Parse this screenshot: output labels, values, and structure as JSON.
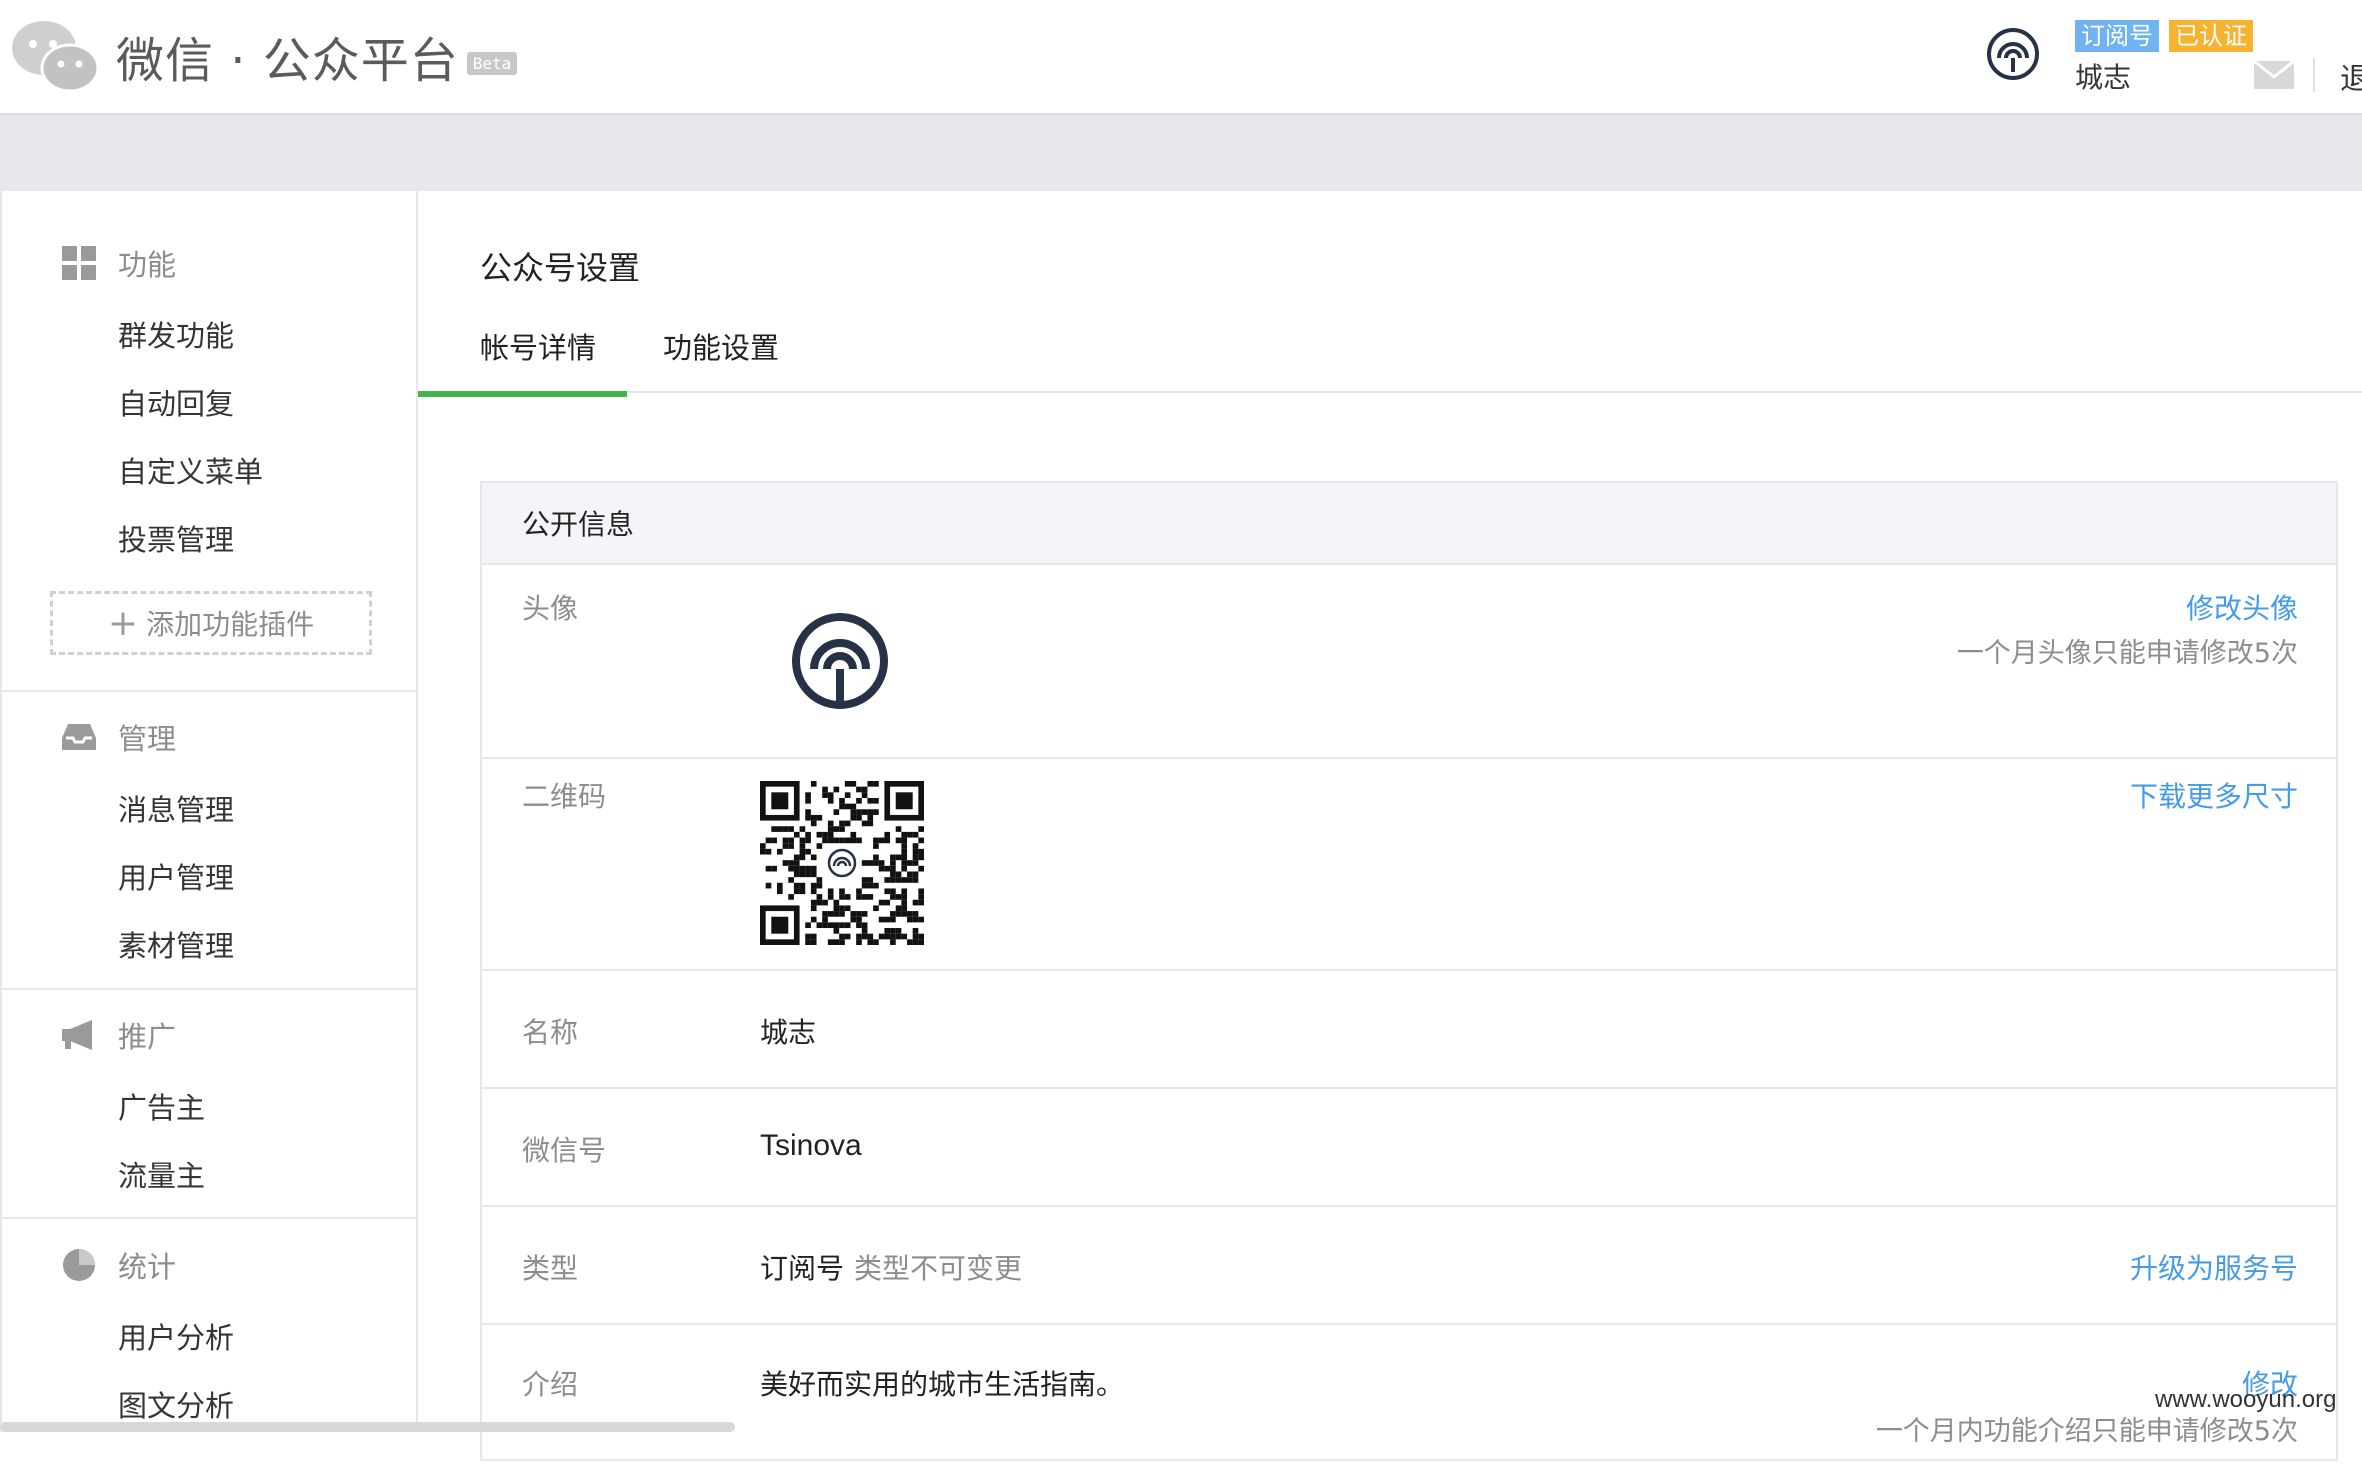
{
  "header": {
    "logo_title": "微信 · 公众平台",
    "beta": "Beta",
    "badge_type": "订阅号",
    "badge_verified": "已认证",
    "account_name": "城志",
    "logout": "退"
  },
  "sidebar": {
    "groups": [
      {
        "title": "功能",
        "icon": "grid-icon",
        "items": [
          "群发功能",
          "自动回复",
          "自定义菜单",
          "投票管理"
        ]
      },
      {
        "title": "管理",
        "icon": "inbox-icon",
        "items": [
          "消息管理",
          "用户管理",
          "素材管理"
        ]
      },
      {
        "title": "推广",
        "icon": "megaphone-icon",
        "items": [
          "广告主",
          "流量主"
        ]
      },
      {
        "title": "统计",
        "icon": "pie-chart-icon",
        "items": [
          "用户分析",
          "图文分析"
        ]
      }
    ],
    "add_plugin": "添加功能插件"
  },
  "main": {
    "page_title": "公众号设置",
    "tabs": [
      "帐号详情",
      "功能设置"
    ],
    "active_tab": "帐号详情",
    "panel_title": "公开信息",
    "rows": {
      "avatar": {
        "label": "头像",
        "link": "修改头像",
        "note": "一个月头像只能申请修改5次"
      },
      "qrcode": {
        "label": "二维码",
        "link": "下载更多尺寸"
      },
      "name": {
        "label": "名称",
        "value": "城志"
      },
      "wechat_id": {
        "label": "微信号",
        "value": "Tsinova"
      },
      "type": {
        "label": "类型",
        "value": "订阅号",
        "note": "类型不可变更",
        "link": "升级为服务号"
      },
      "intro": {
        "label": "介绍",
        "value": "美好而实用的城市生活指南。",
        "link": "修改",
        "note": "一个月内功能介绍只能申请修改5次"
      }
    }
  },
  "watermark": "www.wooyun.org",
  "colors": {
    "accent_green": "#44b549",
    "link_blue": "#459ae9",
    "badge_blue": "#6fb3f0",
    "badge_orange": "#f7b232"
  }
}
